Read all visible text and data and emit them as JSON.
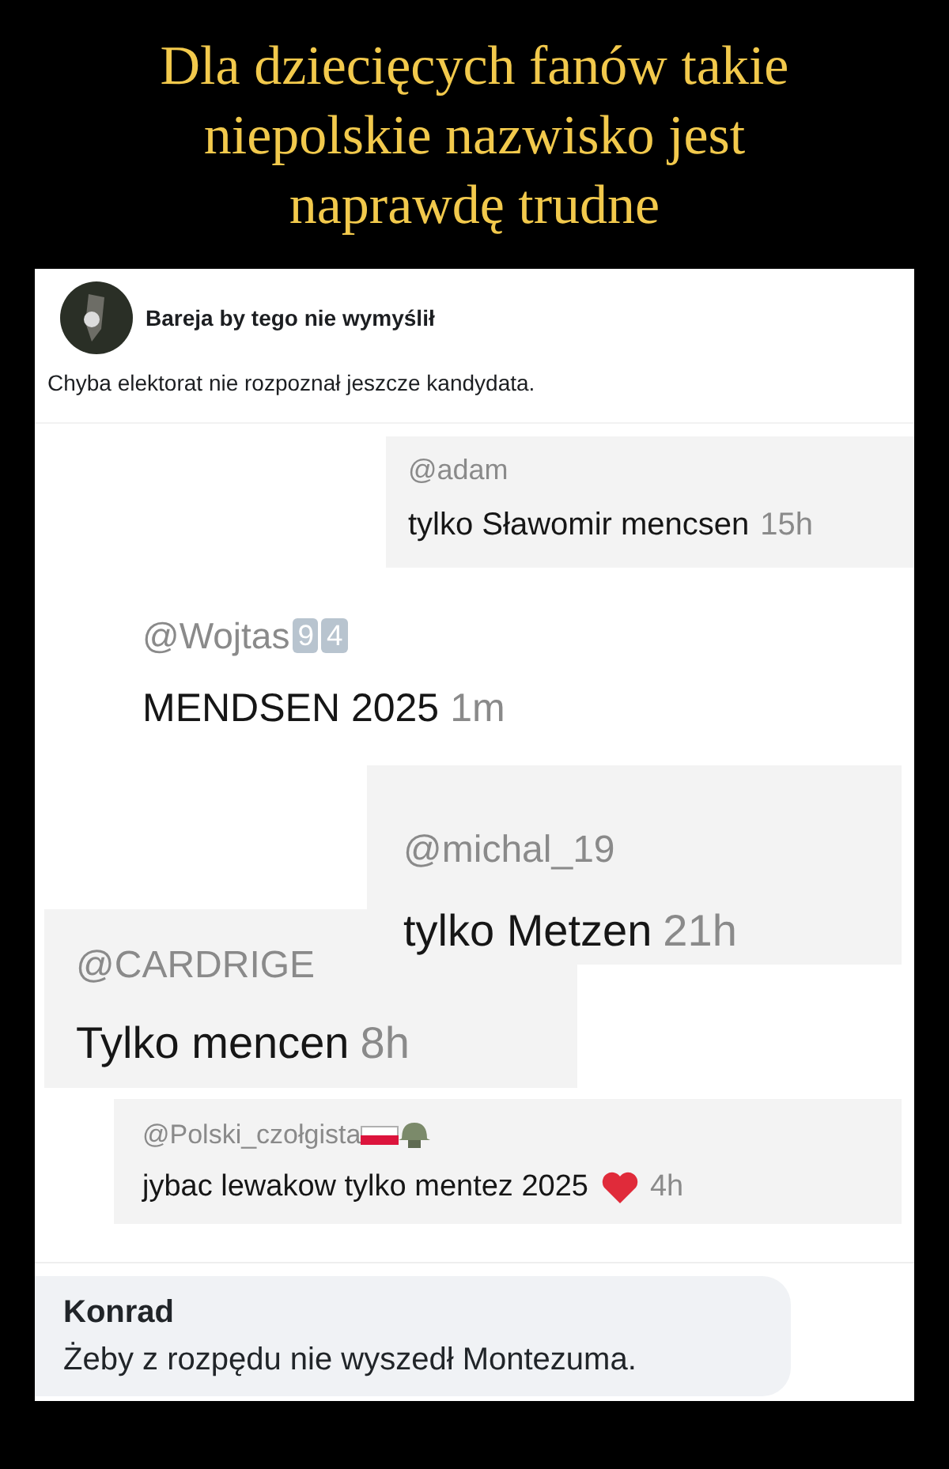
{
  "headline": [
    "Dla dziecięcych fanów takie",
    "niepolskie nazwisko jest",
    "naprawdę trudne"
  ],
  "post": {
    "author": "Bareja by tego nie wymyślił",
    "text": "Chyba elektorat nie rozpoznał jeszcze kandydata."
  },
  "comments": [
    {
      "name": "@adam",
      "text": "tylko Sławomir mencsen",
      "time": "15h",
      "shaded": true
    },
    {
      "name": "@Wojtas",
      "keycaps": [
        "9",
        "4"
      ],
      "text": "MENDSEN 2025",
      "time": "1m",
      "shaded": false
    },
    {
      "name": "@michal_19",
      "text": "tylko Metzen",
      "time": "21h",
      "shaded": true
    },
    {
      "name": "@CARDRIGE",
      "text": "Tylko mencen",
      "time": "8h",
      "shaded": true
    },
    {
      "name": "@Polski_czołgista",
      "flag_and_helmet": true,
      "text": "jybac lewakow tylko mentez 2025",
      "heart": true,
      "time": "4h",
      "shaded": true
    }
  ],
  "reply": {
    "author": "Konrad",
    "text": "Żeby z rozpędu nie wyszedł Montezuma."
  }
}
